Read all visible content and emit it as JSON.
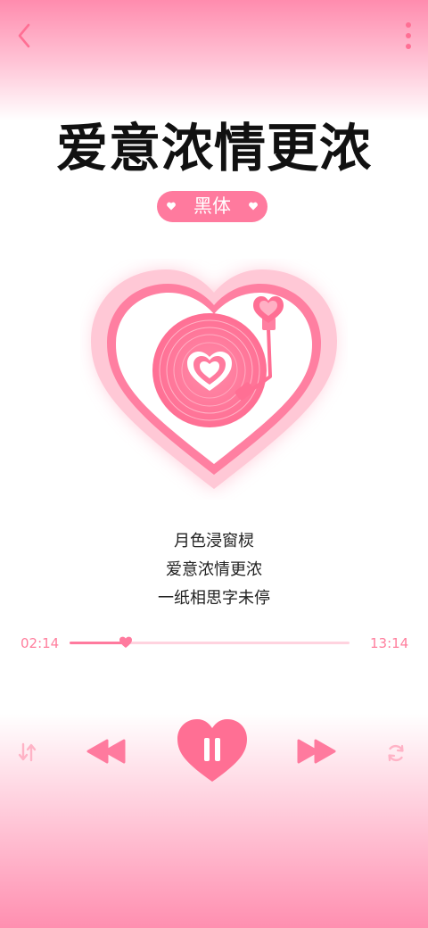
{
  "header": {
    "back_icon": "chevron-left-icon",
    "more_icon": "more-vertical-icon"
  },
  "song": {
    "title": "爱意浓情更浓",
    "font_label": "黑体"
  },
  "lyrics": {
    "line1": "月色浸窗棂",
    "line2": "爱意浓情更浓",
    "line3": "一纸相思字未停"
  },
  "player": {
    "current_time": "02:14",
    "total_time": "13:14",
    "progress": 0.2
  },
  "controls": {
    "shuffle_icon": "shuffle-icon",
    "prev_icon": "rewind-icon",
    "play_icon": "heart-pause-icon",
    "next_icon": "fast-forward-icon",
    "repeat_icon": "repeat-icon"
  },
  "colors": {
    "accent": "#ff7a9e",
    "accent_light": "#ffd3df",
    "text": "#111111"
  }
}
